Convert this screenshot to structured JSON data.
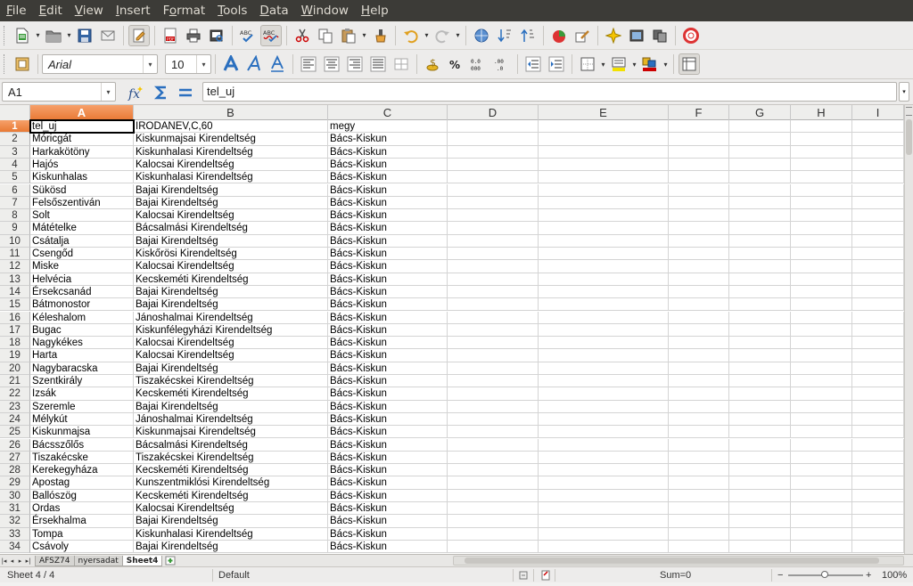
{
  "menu": [
    {
      "label": "File",
      "u": "F",
      "rest": "ile"
    },
    {
      "label": "Edit",
      "u": "E",
      "rest": "dit"
    },
    {
      "label": "View",
      "u": "V",
      "rest": "iew"
    },
    {
      "label": "Insert",
      "u": "I",
      "rest": "nsert"
    },
    {
      "label": "Format",
      "u": "F",
      "pre": "",
      "rest": "ormat",
      "uidx": 1
    },
    {
      "label": "Tools",
      "u": "T",
      "rest": "ools"
    },
    {
      "label": "Data",
      "u": "D",
      "rest": "ata"
    },
    {
      "label": "Window",
      "u": "W",
      "rest": "indow"
    },
    {
      "label": "Help",
      "u": "H",
      "rest": "elp"
    }
  ],
  "font": {
    "name": "Arial",
    "size": "10"
  },
  "name_box": "A1",
  "formula": "tel_uj",
  "columns": [
    "A",
    "B",
    "C",
    "D",
    "E",
    "F",
    "G",
    "H",
    "I"
  ],
  "rows": [
    {
      "n": "1",
      "a": "tel_uj",
      "b": "IRODANEV,C,60",
      "c": "megy"
    },
    {
      "n": "2",
      "a": "Móricgát",
      "b": "Kiskunmajsai Kirendeltség",
      "c": "Bács-Kiskun"
    },
    {
      "n": "3",
      "a": "Harkakötöny",
      "b": "Kiskunhalasi Kirendeltség",
      "c": "Bács-Kiskun"
    },
    {
      "n": "4",
      "a": "Hajós",
      "b": "Kalocsai Kirendeltség",
      "c": "Bács-Kiskun"
    },
    {
      "n": "5",
      "a": "Kiskunhalas",
      "b": "Kiskunhalasi Kirendeltség",
      "c": "Bács-Kiskun"
    },
    {
      "n": "6",
      "a": "Sükösd",
      "b": "Bajai Kirendeltség",
      "c": "Bács-Kiskun"
    },
    {
      "n": "7",
      "a": "Felsőszentiván",
      "b": "Bajai Kirendeltség",
      "c": "Bács-Kiskun"
    },
    {
      "n": "8",
      "a": "Solt",
      "b": "Kalocsai Kirendeltség",
      "c": "Bács-Kiskun"
    },
    {
      "n": "9",
      "a": "Mátételke",
      "b": "Bácsalmási Kirendeltség",
      "c": "Bács-Kiskun"
    },
    {
      "n": "10",
      "a": "Csátalja",
      "b": "Bajai Kirendeltség",
      "c": "Bács-Kiskun"
    },
    {
      "n": "11",
      "a": "Csengőd",
      "b": "Kiskőrösi Kirendeltség",
      "c": "Bács-Kiskun"
    },
    {
      "n": "12",
      "a": "Miske",
      "b": "Kalocsai Kirendeltség",
      "c": "Bács-Kiskun"
    },
    {
      "n": "13",
      "a": "Helvécia",
      "b": "Kecskeméti Kirendeltség",
      "c": "Bács-Kiskun"
    },
    {
      "n": "14",
      "a": "Érsekcsanád",
      "b": "Bajai Kirendeltség",
      "c": "Bács-Kiskun"
    },
    {
      "n": "15",
      "a": "Bátmonostor",
      "b": "Bajai Kirendeltség",
      "c": "Bács-Kiskun"
    },
    {
      "n": "16",
      "a": "Kéleshalom",
      "b": "Jánoshalmai Kirendeltség",
      "c": "Bács-Kiskun"
    },
    {
      "n": "17",
      "a": "Bugac",
      "b": "Kiskunfélegyházi Kirendeltség",
      "c": "Bács-Kiskun"
    },
    {
      "n": "18",
      "a": "Nagykékes",
      "b": "Kalocsai Kirendeltség",
      "c": "Bács-Kiskun"
    },
    {
      "n": "19",
      "a": "Harta",
      "b": "Kalocsai Kirendeltség",
      "c": "Bács-Kiskun"
    },
    {
      "n": "20",
      "a": "Nagybaracska",
      "b": "Bajai Kirendeltség",
      "c": "Bács-Kiskun"
    },
    {
      "n": "21",
      "a": "Szentkirály",
      "b": "Tiszakécskei Kirendeltség",
      "c": "Bács-Kiskun"
    },
    {
      "n": "22",
      "a": "Izsák",
      "b": "Kecskeméti Kirendeltség",
      "c": "Bács-Kiskun"
    },
    {
      "n": "23",
      "a": "Szeremle",
      "b": "Bajai Kirendeltség",
      "c": "Bács-Kiskun"
    },
    {
      "n": "24",
      "a": "Mélykút",
      "b": "Jánoshalmai Kirendeltség",
      "c": "Bács-Kiskun"
    },
    {
      "n": "25",
      "a": "Kiskunmajsa",
      "b": "Kiskunmajsai Kirendeltség",
      "c": "Bács-Kiskun"
    },
    {
      "n": "26",
      "a": "Bácsszőlős",
      "b": "Bácsalmási Kirendeltség",
      "c": "Bács-Kiskun"
    },
    {
      "n": "27",
      "a": "Tiszakécske",
      "b": "Tiszakécskei Kirendeltség",
      "c": "Bács-Kiskun"
    },
    {
      "n": "28",
      "a": "Kerekegyháza",
      "b": "Kecskeméti Kirendeltség",
      "c": "Bács-Kiskun"
    },
    {
      "n": "29",
      "a": "Apostag",
      "b": "Kunszentmiklósi Kirendeltség",
      "c": "Bács-Kiskun"
    },
    {
      "n": "30",
      "a": "Ballószög",
      "b": "Kecskeméti Kirendeltség",
      "c": "Bács-Kiskun"
    },
    {
      "n": "31",
      "a": "Ordas",
      "b": "Kalocsai Kirendeltség",
      "c": "Bács-Kiskun"
    },
    {
      "n": "32",
      "a": "Érsekhalma",
      "b": "Bajai Kirendeltség",
      "c": "Bács-Kiskun"
    },
    {
      "n": "33",
      "a": "Tompa",
      "b": "Kiskunhalasi Kirendeltség",
      "c": "Bács-Kiskun"
    },
    {
      "n": "34",
      "a": "Csávoly",
      "b": "Bajai Kirendeltség",
      "c": "Bács-Kiskun"
    }
  ],
  "sheet_tabs": [
    "AFSZ74",
    "nyersadat",
    "Sheet4"
  ],
  "active_sheet": "Sheet4",
  "status": {
    "sheet": "Sheet 4 / 4",
    "style": "Default",
    "sum": "Sum=0",
    "zoom": "100%"
  },
  "colors": {
    "accent": "#e97934",
    "menubar": "#3c3b37"
  }
}
